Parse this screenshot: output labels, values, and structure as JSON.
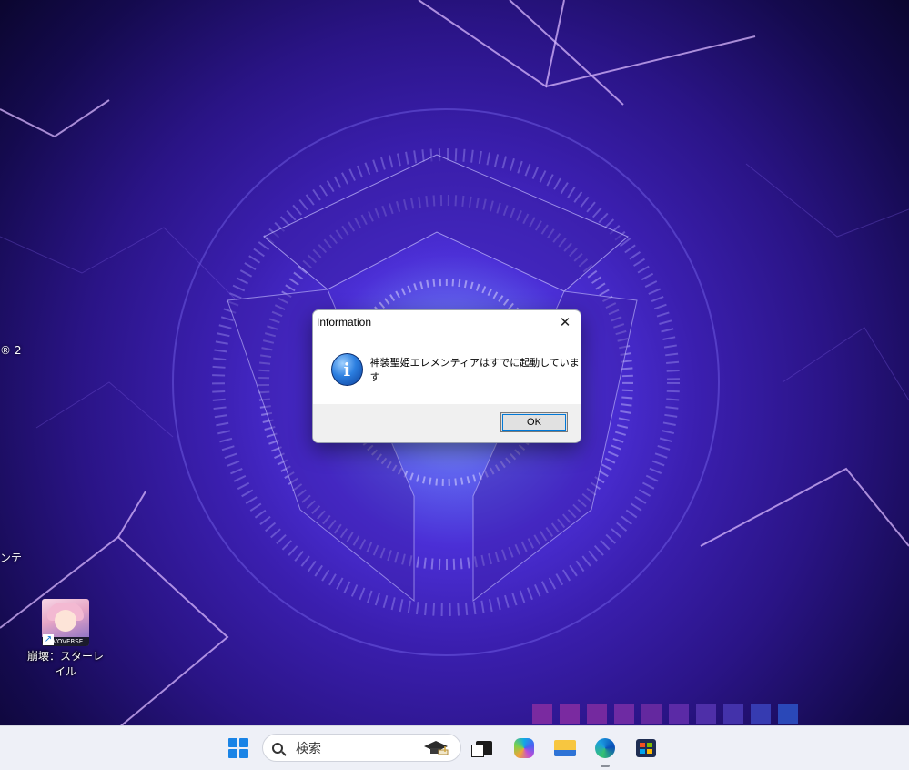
{
  "desktop": {
    "left_edge_fragments": [
      "® 2",
      "ンテ"
    ],
    "shortcut": {
      "label": "崩壊：スターレイル",
      "brand_text": "OVOVERSE"
    }
  },
  "dialog": {
    "title": "Information",
    "close_glyph": "✕",
    "icon_glyph": "i",
    "message": "神装聖姫エレメンティアはすでに起動しています",
    "ok_label": "OK"
  },
  "taskbar": {
    "search_placeholder": "検索",
    "apps": [
      "start-icon",
      "search-box",
      "task-view-icon",
      "copilot-icon",
      "file-explorer-icon",
      "edge-icon",
      "store-icon"
    ]
  },
  "colors": {
    "tile_gradient": [
      "#7a2aa0",
      "#7a2aa0",
      "#74299f",
      "#6e2aa3",
      "#64289f",
      "#5b2aa6",
      "#4e2fa8",
      "#4332aa",
      "#363bb1",
      "#2a48b8"
    ]
  }
}
